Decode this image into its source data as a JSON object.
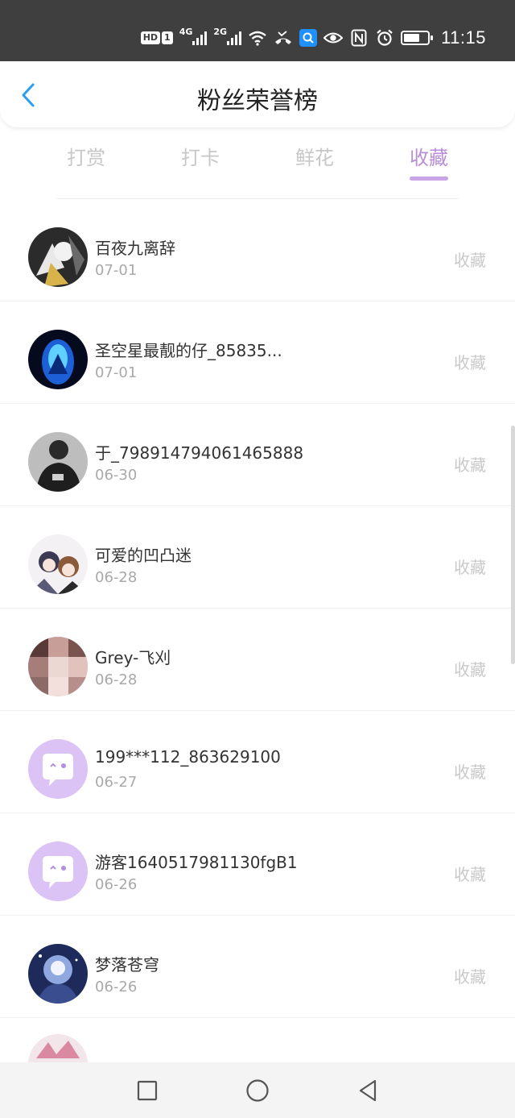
{
  "status_bar": {
    "hd_badge": "HD",
    "sim_badge": "1",
    "net1": "4G",
    "net2": "2G",
    "time": "11:15"
  },
  "header": {
    "title": "粉丝荣誉榜"
  },
  "tabs": [
    {
      "label": "打赏",
      "active": false
    },
    {
      "label": "打卡",
      "active": false
    },
    {
      "label": "鲜花",
      "active": false
    },
    {
      "label": "收藏",
      "active": true
    }
  ],
  "colors": {
    "accent": "#b88ed8",
    "status_bar_bg": "#3f3f3f",
    "back_arrow": "#2a9df4"
  },
  "fans": [
    {
      "name": "百夜九离辞",
      "date": "07-01",
      "action": "收藏",
      "avatar": "anime-avatar"
    },
    {
      "name": "圣空星最靓的仔_85835...",
      "date": "07-01",
      "action": "收藏",
      "avatar": "blue-glow-avatar"
    },
    {
      "name": "于_798914794061465888",
      "date": "06-30",
      "action": "收藏",
      "avatar": "dark-photo-avatar"
    },
    {
      "name": "可爱的凹凸迷",
      "date": "06-28",
      "action": "收藏",
      "avatar": "anime-duo-avatar"
    },
    {
      "name": "Grey-飞刈",
      "date": "06-28",
      "action": "收藏",
      "avatar": "pixelated-avatar"
    },
    {
      "name": "199***112_863629100",
      "date": "06-27",
      "action": "收藏",
      "avatar": "default-chat-avatar"
    },
    {
      "name": "游客1640517981130fgB1",
      "date": "06-26",
      "action": "收藏",
      "avatar": "default-chat-avatar"
    },
    {
      "name": "梦落苍穹",
      "date": "06-26",
      "action": "收藏",
      "avatar": "night-sky-avatar"
    }
  ]
}
